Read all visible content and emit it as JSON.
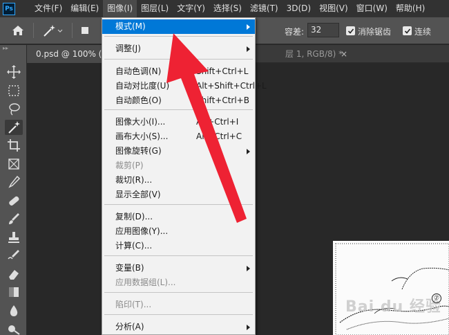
{
  "app": {
    "logo": "Ps"
  },
  "menubar": {
    "items": [
      "文件(F)",
      "编辑(E)",
      "图像(I)",
      "图层(L)",
      "文字(Y)",
      "选择(S)",
      "滤镜(T)",
      "3D(D)",
      "视图(V)",
      "窗口(W)",
      "帮助(H)"
    ],
    "active_index": 2
  },
  "options": {
    "tolerance_label": "容差:",
    "tolerance_value": "32",
    "antialias_label": "消除锯齿",
    "contiguous_label": "连续",
    "antialias_checked": true,
    "contiguous_checked": true
  },
  "tabs": {
    "active": "0.psd @ 100% (图",
    "second": "层 1, RGB/8) *",
    "close_glyph": "×"
  },
  "tools": [
    "move-icon",
    "marquee-icon",
    "lasso-icon",
    "magic-wand-icon",
    "crop-icon",
    "frame-icon",
    "eyedropper-icon",
    "healing-icon",
    "brush-icon",
    "stamp-icon",
    "history-brush-icon",
    "eraser-icon",
    "gradient-icon",
    "blur-icon",
    "dodge-icon"
  ],
  "dropdown": {
    "items": [
      {
        "label": "模式(M)",
        "shortcut": "",
        "submenu": true,
        "highlighted": true,
        "disabled": false
      },
      {
        "label": "调整(J)",
        "shortcut": "",
        "submenu": true,
        "highlighted": false,
        "disabled": false
      },
      {
        "label": "自动色调(N)",
        "shortcut": "Shift+Ctrl+L",
        "submenu": false,
        "highlighted": false,
        "disabled": false
      },
      {
        "label": "自动对比度(U)",
        "shortcut": "Alt+Shift+Ctrl+L",
        "submenu": false,
        "highlighted": false,
        "disabled": false
      },
      {
        "label": "自动颜色(O)",
        "shortcut": "Shift+Ctrl+B",
        "submenu": false,
        "highlighted": false,
        "disabled": false
      },
      {
        "label": "图像大小(I)...",
        "shortcut": "Alt+Ctrl+I",
        "submenu": false,
        "highlighted": false,
        "disabled": false
      },
      {
        "label": "画布大小(S)...",
        "shortcut": "Alt+Ctrl+C",
        "submenu": false,
        "highlighted": false,
        "disabled": false
      },
      {
        "label": "图像旋转(G)",
        "shortcut": "",
        "submenu": true,
        "highlighted": false,
        "disabled": false
      },
      {
        "label": "裁剪(P)",
        "shortcut": "",
        "submenu": false,
        "highlighted": false,
        "disabled": true
      },
      {
        "label": "裁切(R)...",
        "shortcut": "",
        "submenu": false,
        "highlighted": false,
        "disabled": false
      },
      {
        "label": "显示全部(V)",
        "shortcut": "",
        "submenu": false,
        "highlighted": false,
        "disabled": false
      },
      {
        "label": "复制(D)...",
        "shortcut": "",
        "submenu": false,
        "highlighted": false,
        "disabled": false
      },
      {
        "label": "应用图像(Y)...",
        "shortcut": "",
        "submenu": false,
        "highlighted": false,
        "disabled": false
      },
      {
        "label": "计算(C)...",
        "shortcut": "",
        "submenu": false,
        "highlighted": false,
        "disabled": false
      },
      {
        "label": "变量(B)",
        "shortcut": "",
        "submenu": true,
        "highlighted": false,
        "disabled": false
      },
      {
        "label": "应用数据组(L)...",
        "shortcut": "",
        "submenu": false,
        "highlighted": false,
        "disabled": true
      },
      {
        "label": "陷印(T)...",
        "shortcut": "",
        "submenu": false,
        "highlighted": false,
        "disabled": true
      },
      {
        "label": "分析(A)",
        "shortcut": "",
        "submenu": true,
        "highlighted": false,
        "disabled": false
      }
    ]
  },
  "canvas": {
    "watermark": "Bai du 经验",
    "circle_label": "⑦"
  },
  "colors": {
    "accent": "#0078d7",
    "annotation_arrow": "#ee2233"
  }
}
